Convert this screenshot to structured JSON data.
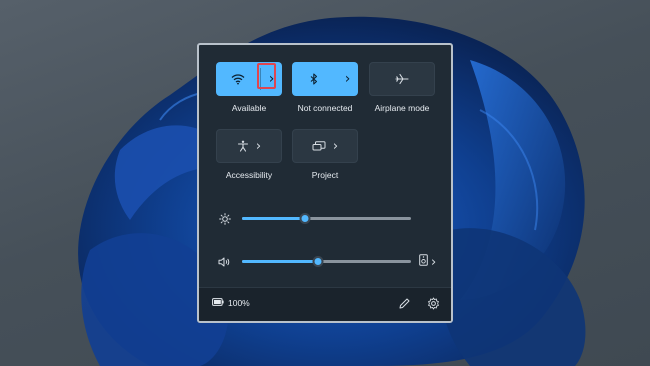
{
  "tiles": [
    {
      "id": "wifi",
      "label": "Available",
      "icon": "wifi-icon",
      "state": "on"
    },
    {
      "id": "bluetooth",
      "label": "Not connected",
      "icon": "bluetooth-icon",
      "state": "on"
    },
    {
      "id": "airplane",
      "label": "Airplane mode",
      "icon": "airplane-icon",
      "state": "off"
    },
    {
      "id": "accessibility",
      "label": "Accessibility",
      "icon": "accessibility-icon",
      "state": "off"
    },
    {
      "id": "project",
      "label": "Project",
      "icon": "project-icon",
      "state": "off"
    }
  ],
  "chevron": "›",
  "sliders": {
    "brightness": {
      "icon": "brightness-icon",
      "value": 0.37
    },
    "volume": {
      "icon": "volume-icon",
      "value": 0.45
    }
  },
  "footer": {
    "battery_label": "100%",
    "battery_icon": "battery-icon",
    "edit_icon": "pencil-icon",
    "settings_icon": "gear-icon"
  },
  "colors": {
    "accent": "#52b8ff",
    "highlight": "#e0464f",
    "panel": "#202b35"
  }
}
